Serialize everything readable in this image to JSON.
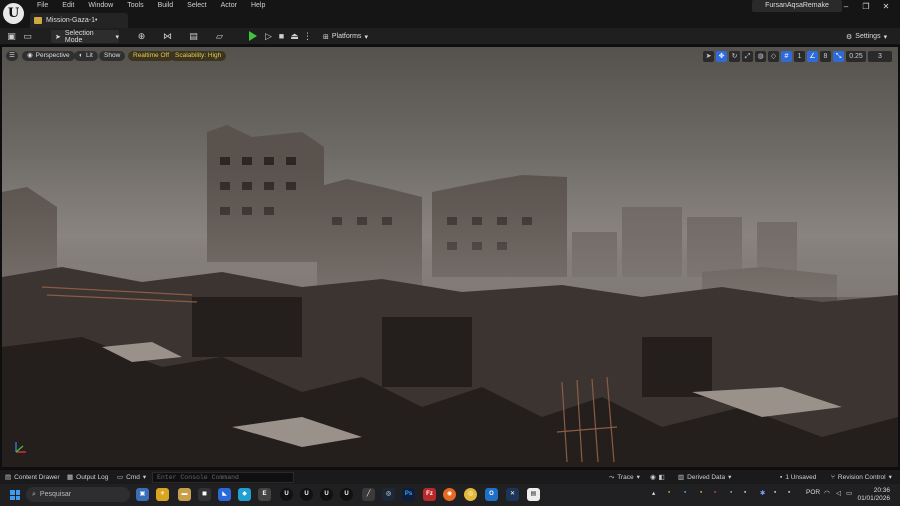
{
  "menubar": [
    "File",
    "Edit",
    "Window",
    "Tools",
    "Build",
    "Select",
    "Actor",
    "Help"
  ],
  "document_tab": "Mission-Gaza-1•",
  "project_name": "FursanAqsaRemake",
  "toolbar": {
    "selection_mode": "Selection Mode",
    "platforms": "Platforms",
    "settings": "Settings"
  },
  "viewport": {
    "perspective": "Perspective",
    "lit": "Lit",
    "show": "Show",
    "realtime": "Realtime Off",
    "scalability": "Scalability: High",
    "grid_value": "1",
    "angle_value": "8",
    "scale_value": "0.25",
    "camera_value": "3"
  },
  "bottombar": {
    "content_drawer": "Content Drawer",
    "output_log": "Output Log",
    "cmd": "Cmd",
    "console_placeholder": "Enter Console Command",
    "trace": "Trace",
    "derived_data": "Derived Data",
    "unsaved": "1 Unsaved",
    "revision_control": "Revision Control"
  },
  "taskbar": {
    "search": "Pesquisar",
    "lang": "POR",
    "time": "20:36",
    "date": "01/01/2026"
  },
  "colors": {
    "accent_blue": "#2f6bd8",
    "play_green": "#3ec43e",
    "warn_yellow": "#e8c850"
  }
}
